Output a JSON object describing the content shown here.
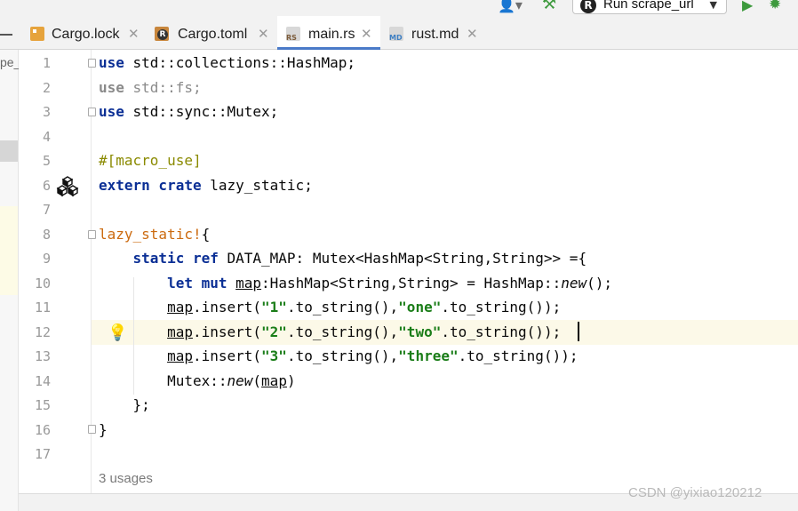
{
  "toolbar": {
    "run_config_label": "Run scrape_url",
    "icons": [
      "user-icon",
      "build-hammer-icon",
      "rust-logo-icon",
      "dropdown-arrow-icon",
      "run-icon",
      "debug-icon"
    ]
  },
  "tabs": [
    {
      "label": "Cargo.lock",
      "icon": "cargo-lock-file-icon",
      "active": false
    },
    {
      "label": "Cargo.toml",
      "icon": "cargo-toml-file-icon",
      "active": false
    },
    {
      "label": "main.rs",
      "icon": "rust-file-icon",
      "icon_text": "RS",
      "active": true
    },
    {
      "label": "rust.md",
      "icon": "markdown-file-icon",
      "icon_text": "MD",
      "active": false
    }
  ],
  "project_panel": {
    "visible_text": "pe_"
  },
  "editor": {
    "line_numbers": [
      "1",
      "2",
      "3",
      "4",
      "5",
      "6",
      "7",
      "8",
      "9",
      "10",
      "11",
      "12",
      "13",
      "14",
      "15",
      "16",
      "17"
    ],
    "current_line": 12,
    "inlay_usages": "3 usages"
  },
  "colors": {
    "keyword": "#0b2f95",
    "string": "#1a7d18",
    "macro": "#cc6b10",
    "attribute": "#8a8a00",
    "current_line_bg": "#fcf9e8",
    "tab_underline": "#4a7ac8"
  },
  "watermark": "CSDN @yixiao120212"
}
